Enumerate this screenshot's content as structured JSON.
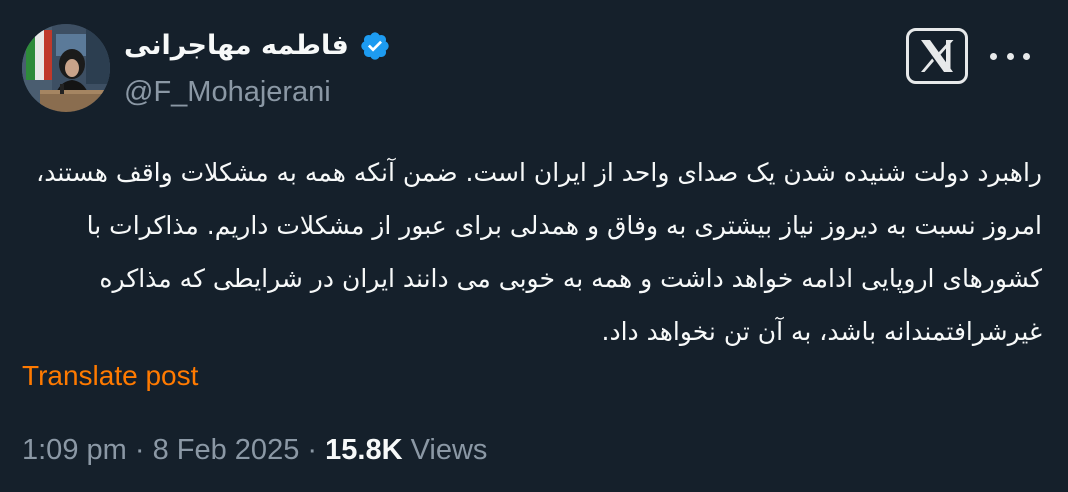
{
  "author": {
    "display_name": "فاطمه مهاجرانی",
    "handle": "@F_Mohajerani",
    "verified": true,
    "avatar_icon": "profile-photo"
  },
  "post": {
    "text": "راهبرد دولت شنیده شدن یک صدای واحد از ایران است. ضمن آنکه همه به مشکلات واقف هستند، امروز نسبت به دیروز نیاز بیشتری به وفاق و همدلی برای عبور از مشکلات داریم. مذاکرات با کشورهای اروپایی ادامه خواهد داشت و همه به خوبی می دانند ایران در شرایطی که مذاکره غیرشرافتمندانه باشد، به آن تن نخواهد داد.",
    "translate_label": "Translate post"
  },
  "meta": {
    "time": "1:09 pm",
    "separator": "·",
    "date": "8 Feb 2025",
    "views_count": "15.8K",
    "views_label": "Views"
  },
  "icons": {
    "verified_badge": "verified-badge-icon",
    "x_logo": "x-logo-icon",
    "more": "more-options-icon"
  },
  "colors": {
    "background": "#15202b",
    "text_primary": "#f7f9f9",
    "text_secondary": "#8b98a5",
    "verified_blue": "#1d9bf0",
    "translate_link": "#ff7a00"
  }
}
